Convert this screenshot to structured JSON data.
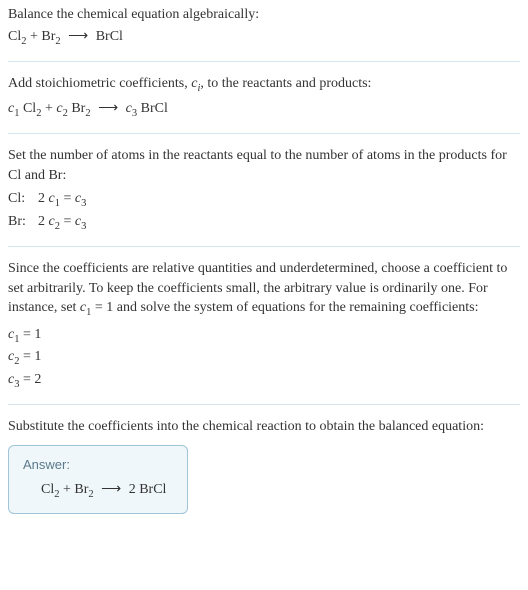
{
  "step1": {
    "text": "Balance the chemical equation algebraically:",
    "equation_html": "Cl<span class=\"sub\">2</span> + Br<span class=\"sub\">2</span> <span class=\"arrow\">⟶</span> BrCl"
  },
  "step2": {
    "text_html": "Add stoichiometric coefficients, <span class=\"italic\">c<span class=\"sub\">i</span></span>, to the reactants and products:",
    "equation_html": "<span class=\"italic\">c</span><span class=\"sub\">1</span> Cl<span class=\"sub\">2</span> + <span class=\"italic\">c</span><span class=\"sub\">2</span> Br<span class=\"sub\">2</span> <span class=\"arrow\">⟶</span> <span class=\"italic\">c</span><span class=\"sub\">3</span> BrCl"
  },
  "step3": {
    "text": "Set the number of atoms in the reactants equal to the number of atoms in the products for Cl and Br:",
    "rows": [
      {
        "label": "Cl:",
        "expr_html": "2 <span class=\"italic\">c</span><span class=\"sub\">1</span> = <span class=\"italic\">c</span><span class=\"sub\">3</span>"
      },
      {
        "label": "Br:",
        "expr_html": "2 <span class=\"italic\">c</span><span class=\"sub\">2</span> = <span class=\"italic\">c</span><span class=\"sub\">3</span>"
      }
    ]
  },
  "step4": {
    "text_html": "Since the coefficients are relative quantities and underdetermined, choose a coefficient to set arbitrarily. To keep the coefficients small, the arbitrary value is ordinarily one. For instance, set <span class=\"italic\">c</span><span class=\"sub\">1</span> = 1 and solve the system of equations for the remaining coefficients:",
    "coeffs": [
      "<span class=\"italic\">c</span><span class=\"sub\">1</span> = 1",
      "<span class=\"italic\">c</span><span class=\"sub\">2</span> = 1",
      "<span class=\"italic\">c</span><span class=\"sub\">3</span> = 2"
    ]
  },
  "step5": {
    "text": "Substitute the coefficients into the chemical reaction to obtain the balanced equation:",
    "answer_label": "Answer:",
    "answer_html": "Cl<span class=\"sub\">2</span> + Br<span class=\"sub\">2</span> <span class=\"arrow\">⟶</span> 2 BrCl"
  }
}
